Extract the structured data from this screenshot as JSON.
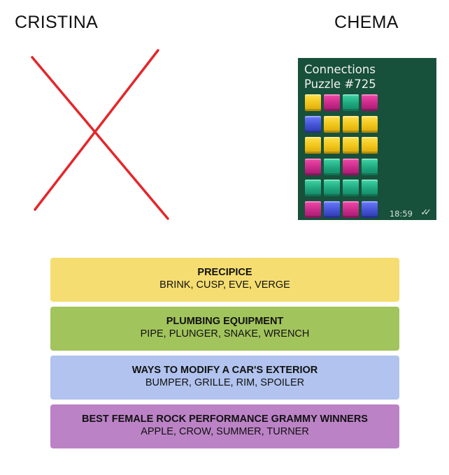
{
  "players": {
    "left_name": "CRISTINA",
    "right_name": "CHEMA"
  },
  "colors": {
    "cross": "#e4262a",
    "card_bg": "#17503b",
    "yellow": "#f0c419",
    "green": "#1fa67e",
    "blue": "#4353d3",
    "purple": "#c82a8a"
  },
  "share_card": {
    "title_line_1": "Connections",
    "title_line_2": "Puzzle #725",
    "grid": [
      [
        "yellow",
        "purple",
        "green",
        "purple"
      ],
      [
        "blue",
        "yellow",
        "yellow",
        "yellow"
      ],
      [
        "yellow",
        "yellow",
        "yellow",
        "yellow"
      ],
      [
        "purple",
        "green",
        "purple",
        "green"
      ],
      [
        "green",
        "green",
        "green",
        "green"
      ],
      [
        "purple",
        "blue",
        "purple",
        "blue"
      ]
    ],
    "time": "18:59",
    "status_icon": "double-check-icon"
  },
  "groups": [
    {
      "title": "PRECIPICE",
      "words": "BRINK, CUSP, EVE, VERGE",
      "color": "#f5dd71"
    },
    {
      "title": "PLUMBING EQUIPMENT",
      "words": "PIPE, PLUNGER, SNAKE, WRENCH",
      "color": "#a2c45c"
    },
    {
      "title": "WAYS TO MODIFY A CAR'S EXTERIOR",
      "words": "BUMPER, GRILLE, RIM, SPOILER",
      "color": "#b1c3ee"
    },
    {
      "title": "BEST FEMALE ROCK PERFORMANCE GRAMMY WINNERS",
      "words": "APPLE, CROW, SUMMER, TURNER",
      "color": "#bb82c6"
    }
  ]
}
